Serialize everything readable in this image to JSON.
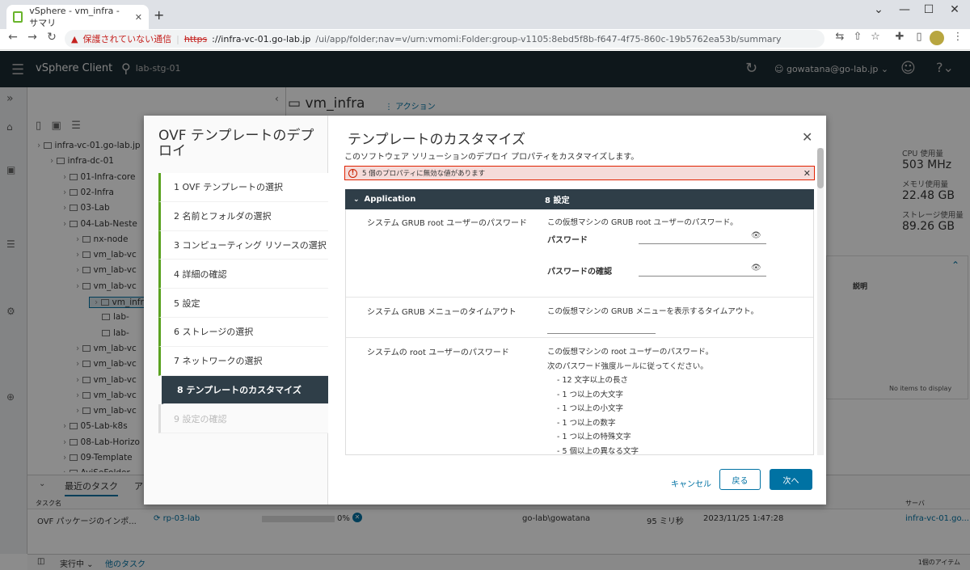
{
  "browser": {
    "tab_title": "vSphere - vm_infra - サマリ",
    "address_warning": "保護されていない通信",
    "url_scheme": "https",
    "url_host": "://infra-vc-01.go-lab.jp",
    "url_path": "/ui/app/folder;nav=v/urn:vmomi:Folder:group-v1105:8ebd5f8b-f647-4f75-860c-19b5762ea53b/summary"
  },
  "header": {
    "app_title": "vSphere Client",
    "search_text": "lab-stg-01",
    "user": "gowatana@go-lab.jp"
  },
  "nav_tree": [
    {
      "label": "infra-vc-01.go-lab.jp",
      "indent": 0
    },
    {
      "label": "infra-dc-01",
      "indent": 1
    },
    {
      "label": "01-Infra-core",
      "indent": 2
    },
    {
      "label": "02-Infra",
      "indent": 2
    },
    {
      "label": "03-Lab",
      "indent": 2
    },
    {
      "label": "04-Lab-Neste",
      "indent": 2
    },
    {
      "label": "nx-node",
      "indent": 3
    },
    {
      "label": "vm_lab-vc",
      "indent": 3
    },
    {
      "label": "vm_lab-vc",
      "indent": 3
    },
    {
      "label": "vm_lab-vc",
      "indent": 3
    },
    {
      "label": "vm_infr",
      "indent": 4
    },
    {
      "label": "lab-",
      "indent": 5
    },
    {
      "label": "lab-",
      "indent": 5
    },
    {
      "label": "vm_lab-vc",
      "indent": 3
    },
    {
      "label": "vm_lab-vc",
      "indent": 3
    },
    {
      "label": "vm_lab-vc",
      "indent": 3
    },
    {
      "label": "vm_lab-vc",
      "indent": 3
    },
    {
      "label": "vm_lab-vc",
      "indent": 3
    },
    {
      "label": "05-Lab-k8s",
      "indent": 2
    },
    {
      "label": "08-Lab-Horizo",
      "indent": 2
    },
    {
      "label": "09-Template",
      "indent": 2
    },
    {
      "label": "AviSeFolder",
      "indent": 2
    }
  ],
  "page": {
    "title": "vm_infra",
    "action": "アクション",
    "stats": [
      {
        "label": "CPU 使用量",
        "value": "503 MHz"
      },
      {
        "label": "メモリ使用量",
        "value": "22.48 GB"
      },
      {
        "label": "ストレージ使用量",
        "value": "89.26 GB"
      }
    ],
    "right_col": "説明",
    "no_items": "No items to display"
  },
  "tasks": {
    "tab_recent": "最近のタスク",
    "tab_alarm": "ア",
    "col_name": "タスク名",
    "col_server": "サーバ",
    "row": {
      "name": "OVF パッケージのインポ...",
      "target": "rp-03-lab",
      "progress": "0%",
      "progress_fraction": 0,
      "initiator": "go-lab\\gowatana",
      "queued": "95 ミリ秒",
      "start": "2023/11/25 1:47:28",
      "server": "infra-vc-01.go..."
    },
    "status_running": "実行中",
    "status_other": "他のタスク",
    "item_count": "1個のアイテム"
  },
  "wizard": {
    "title": "OVF テンプレートのデプロイ",
    "steps": [
      {
        "label": "1  OVF テンプレートの選択",
        "state": "done"
      },
      {
        "label": "2  名前とフォルダの選択",
        "state": "done"
      },
      {
        "label": "3  コンピューティング リソースの選択",
        "state": "done"
      },
      {
        "label": "4  詳細の確認",
        "state": "done"
      },
      {
        "label": "5  設定",
        "state": "done"
      },
      {
        "label": "6  ストレージの選択",
        "state": "done"
      },
      {
        "label": "7  ネットワークの選択",
        "state": "done"
      },
      {
        "label": "8  テンプレートのカスタマイズ",
        "state": "active"
      },
      {
        "label": "9  設定の確認",
        "state": "disabled"
      }
    ],
    "page_title": "テンプレートのカスタマイズ",
    "subtitle": "このソフトウェア ソリューションのデプロイ プロパティをカスタマイズします。",
    "alert": "5 個のプロパティに無効な値があります",
    "group_name": "Application",
    "group_count": "8 設定",
    "props": {
      "grub_pw_label": "システム GRUB root ユーザーのパスワード",
      "grub_pw_desc": "この仮想マシンの GRUB root ユーザーのパスワード。",
      "password_label": "パスワード",
      "password_confirm_label": "パスワードの確認",
      "grub_timeout_label": "システム GRUB メニューのタイムアウト",
      "grub_timeout_desc": "この仮想マシンの GRUB メニューを表示するタイムアウト。",
      "root_pw_label": "システムの root ユーザーのパスワード",
      "root_pw_desc1": "この仮想マシンの root ユーザーのパスワード。",
      "root_pw_desc2": "次のパスワード強度ルールに従ってください。",
      "rules": [
        "- 12 文字以上の長さ",
        "- 1 つ以上の大文字",
        "- 1 つ以上の小文字",
        "- 1 つ以上の数字",
        "- 1 つ以上の特殊文字",
        "- 5 個以上の異なる文字"
      ]
    },
    "buttons": {
      "cancel": "キャンセル",
      "back": "戻る",
      "next": "次へ"
    }
  }
}
